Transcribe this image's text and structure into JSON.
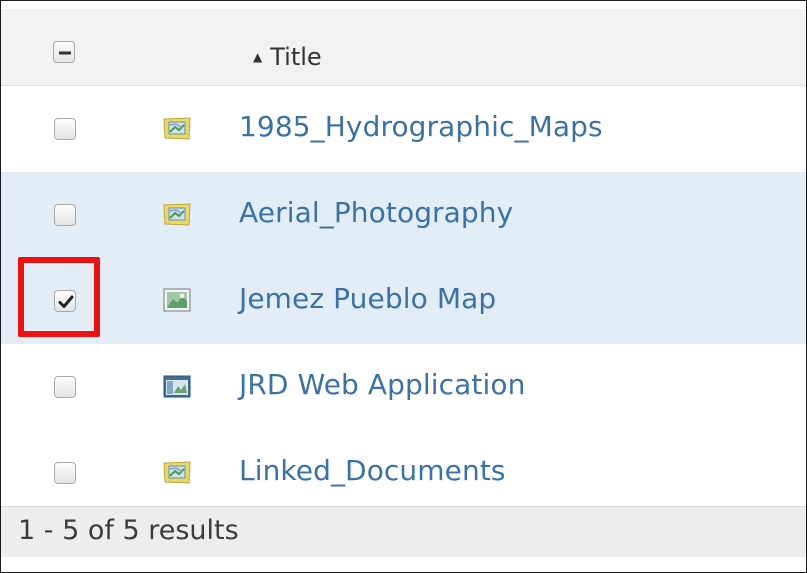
{
  "header": {
    "sort_indicator": "▲",
    "title_column": "Title",
    "select_all_state": "indeterminate"
  },
  "rows": [
    {
      "title": "1985_Hydrographic_Maps",
      "checked": false,
      "icon": "map-layer-icon"
    },
    {
      "title": "Aerial_Photography",
      "checked": false,
      "icon": "map-layer-icon"
    },
    {
      "title": "Jemez Pueblo Map",
      "checked": true,
      "icon": "web-map-icon"
    },
    {
      "title": "JRD Web Application",
      "checked": false,
      "icon": "web-application-icon"
    },
    {
      "title": "Linked_Documents",
      "checked": false,
      "icon": "map-layer-icon"
    }
  ],
  "footer": {
    "results_text": "1 - 5 of 5 results"
  },
  "colors": {
    "link": "#3a72a8",
    "selected_row": "#e3edf6",
    "highlight_box": "#ee1111"
  }
}
